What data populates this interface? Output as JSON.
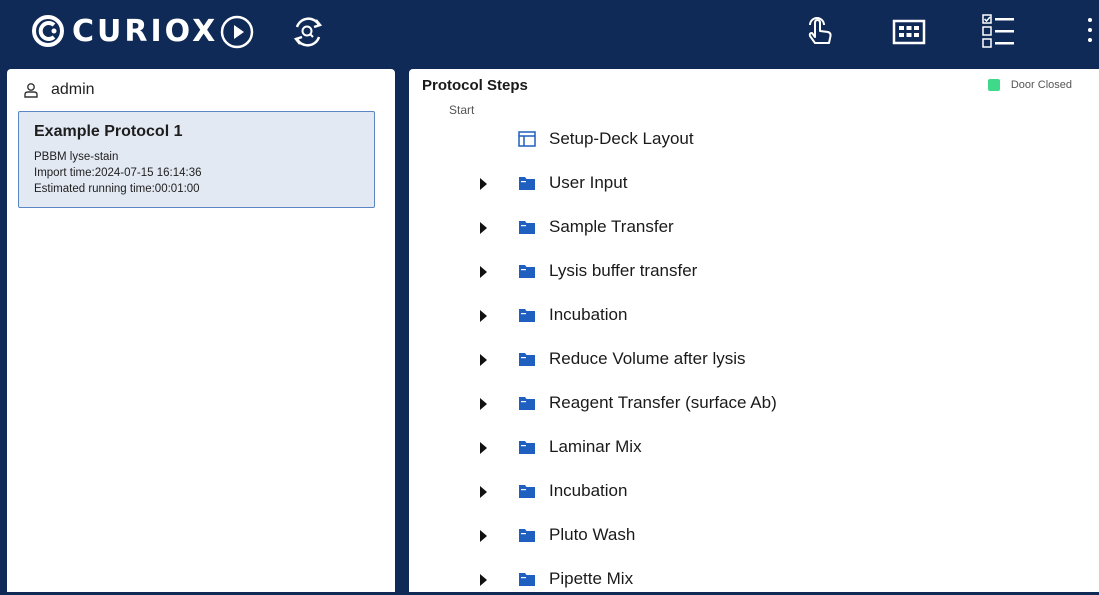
{
  "header": {
    "logo_text": "CURIOX",
    "icons": [
      "logo-c-icon",
      "play-icon",
      "refresh-search-icon",
      "touch-icon",
      "grid-plate-icon",
      "checklist-icon",
      "more-vert-icon"
    ]
  },
  "sidebar": {
    "user": {
      "name": "admin"
    },
    "protocols": [
      {
        "title": "Example Protocol 1",
        "subtitle": "PBBM lyse-stain",
        "import_time": "Import time:2024-07-15 16:14:36",
        "running_time": "Estimated running time:00:01:00"
      }
    ]
  },
  "main": {
    "title": "Protocol Steps",
    "door_status": "Door Closed",
    "start_label": "Start",
    "steps": [
      {
        "label": "Setup-Deck Layout",
        "icon": "layout-icon",
        "expandable": false
      },
      {
        "label": "User Input",
        "icon": "folder-icon",
        "expandable": true
      },
      {
        "label": "Sample Transfer",
        "icon": "folder-icon",
        "expandable": true
      },
      {
        "label": "Lysis buffer transfer",
        "icon": "folder-icon",
        "expandable": true
      },
      {
        "label": "Incubation",
        "icon": "folder-icon",
        "expandable": true
      },
      {
        "label": "Reduce Volume after lysis",
        "icon": "folder-icon",
        "expandable": true
      },
      {
        "label": "Reagent Transfer (surface Ab)",
        "icon": "folder-icon",
        "expandable": true
      },
      {
        "label": "Laminar Mix",
        "icon": "folder-icon",
        "expandable": true
      },
      {
        "label": "Incubation",
        "icon": "folder-icon",
        "expandable": true
      },
      {
        "label": "Pluto Wash",
        "icon": "folder-icon",
        "expandable": true
      },
      {
        "label": "Pipette Mix",
        "icon": "folder-icon",
        "expandable": true
      }
    ]
  },
  "colors": {
    "nav_bg": "#0f2a57",
    "folder_blue": "#1f5fbf",
    "card_bg": "#e3e9f3",
    "card_border": "#5b86c4",
    "door_closed": "#3fd98a"
  }
}
